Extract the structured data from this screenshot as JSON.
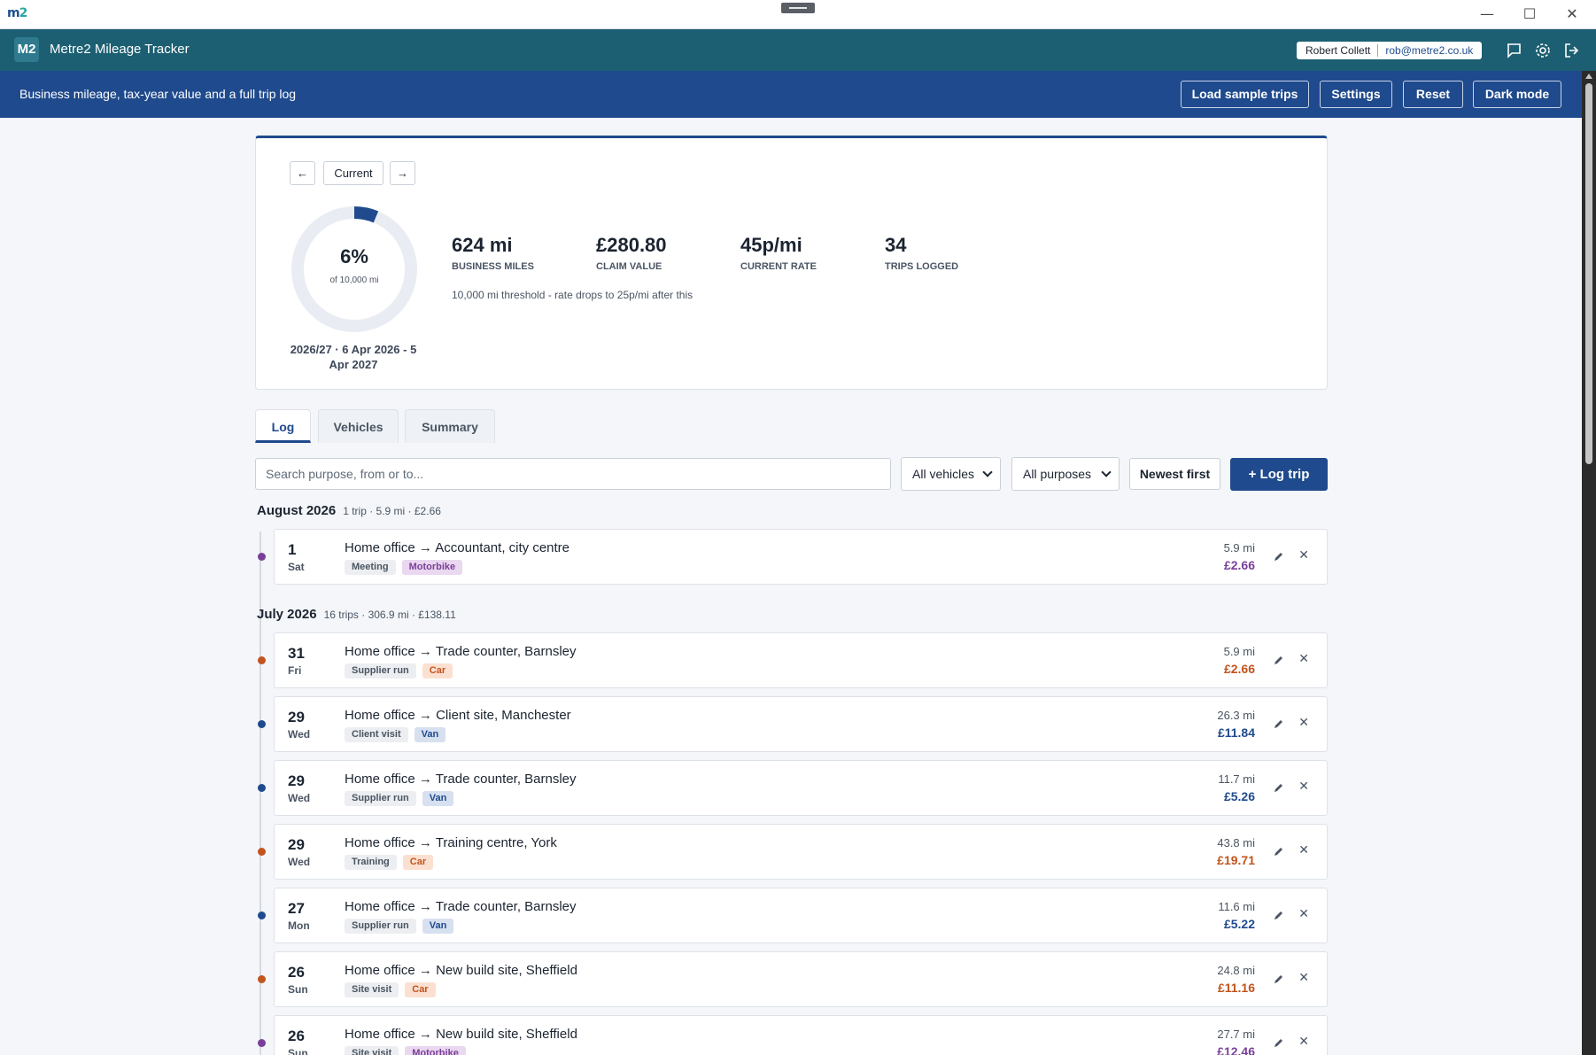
{
  "window": {
    "logo_m": "m",
    "logo_2": "2",
    "minimize": "—",
    "maximize": "☐",
    "close": "✕"
  },
  "header": {
    "badge": "M2",
    "title": "Metre2 Mileage Tracker",
    "user_name": "Robert Collett",
    "user_email": "rob@metre2.co.uk",
    "icons": [
      "chat-icon",
      "gear-icon",
      "logout-icon"
    ]
  },
  "toolbar": {
    "tagline": "Business mileage, tax-year value and a full trip log",
    "load_sample": "Load sample trips",
    "settings": "Settings",
    "reset": "Reset",
    "dark_mode": "Dark mode"
  },
  "summary": {
    "prev": "←",
    "current": "Current",
    "next": "→",
    "progress_pct": "6%",
    "progress_fraction": 0.0624,
    "progress_of": "of 10,000 mi",
    "tax_year": "2026/27 · 6 Apr 2026 - 5 Apr 2027",
    "stats": [
      {
        "value": "624 mi",
        "label": "Business miles"
      },
      {
        "value": "£280.80",
        "label": "Claim value"
      },
      {
        "value": "45p/mi",
        "label": "Current rate"
      },
      {
        "value": "34",
        "label": "Trips logged"
      }
    ],
    "threshold_note": "10,000 mi threshold - rate drops to 25p/mi after this"
  },
  "tabs": [
    {
      "label": "Log",
      "active": true
    },
    {
      "label": "Vehicles",
      "active": false
    },
    {
      "label": "Summary",
      "active": false
    }
  ],
  "filters": {
    "search_placeholder": "Search purpose, from or to...",
    "vehicle_selected": "All vehicles",
    "purpose_selected": "All purposes",
    "sort": "Newest first",
    "log_trip": "+ Log trip"
  },
  "colors": {
    "car": "#c2541d",
    "van": "#1f4a8d",
    "motorbike": "#7a3f99"
  },
  "months": [
    {
      "name": "August 2026",
      "summary": "1 trip · 5.9 mi · £2.66",
      "trips": [
        {
          "day": "1",
          "dow": "Sat",
          "route": "Home office → Accountant, city centre",
          "purpose": "Meeting",
          "vehicle": "Motorbike",
          "vclass": "moto",
          "miles": "5.9 mi",
          "amount": "£2.66"
        }
      ]
    },
    {
      "name": "July 2026",
      "summary": "16 trips · 306.9 mi · £138.11",
      "trips": [
        {
          "day": "31",
          "dow": "Fri",
          "route": "Home office → Trade counter, Barnsley",
          "purpose": "Supplier run",
          "vehicle": "Car",
          "vclass": "car",
          "miles": "5.9 mi",
          "amount": "£2.66"
        },
        {
          "day": "29",
          "dow": "Wed",
          "route": "Home office → Client site, Manchester",
          "purpose": "Client visit",
          "vehicle": "Van",
          "vclass": "van",
          "miles": "26.3 mi",
          "amount": "£11.84"
        },
        {
          "day": "29",
          "dow": "Wed",
          "route": "Home office → Trade counter, Barnsley",
          "purpose": "Supplier run",
          "vehicle": "Van",
          "vclass": "van",
          "miles": "11.7 mi",
          "amount": "£5.26"
        },
        {
          "day": "29",
          "dow": "Wed",
          "route": "Home office → Training centre, York",
          "purpose": "Training",
          "vehicle": "Car",
          "vclass": "car",
          "miles": "43.8 mi",
          "amount": "£19.71"
        },
        {
          "day": "27",
          "dow": "Mon",
          "route": "Home office → Trade counter, Barnsley",
          "purpose": "Supplier run",
          "vehicle": "Van",
          "vclass": "van",
          "miles": "11.6 mi",
          "amount": "£5.22"
        },
        {
          "day": "26",
          "dow": "Sun",
          "route": "Home office → New build site, Sheffield",
          "purpose": "Site visit",
          "vehicle": "Car",
          "vclass": "car",
          "miles": "24.8 mi",
          "amount": "£11.16"
        },
        {
          "day": "26",
          "dow": "Sun",
          "route": "Home office → New build site, Sheffield",
          "purpose": "Site visit",
          "vehicle": "Motorbike",
          "vclass": "moto",
          "miles": "27.7 mi",
          "amount": "£12.46"
        }
      ]
    }
  ]
}
